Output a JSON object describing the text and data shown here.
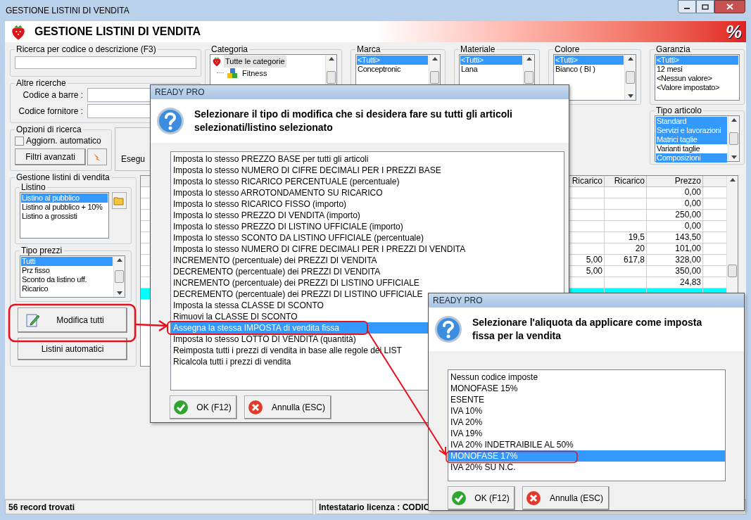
{
  "window": {
    "title": "GESTIONE LISTINI DI VENDITA"
  },
  "header": {
    "title": "GESTIONE LISTINI DI VENDITA",
    "logo": "%"
  },
  "search": {
    "title": "Ricerca per codice o descrizione (F3)"
  },
  "other_searches": {
    "title": "Altre ricerche",
    "fields": [
      {
        "label": "Codice a barre :"
      },
      {
        "label": "Codice fornitore :"
      }
    ]
  },
  "search_options": {
    "title": "Opzioni di ricerca",
    "auto_update": {
      "label": "Aggiorn. automatico",
      "checked": false
    },
    "advanced_button": "Filtri avanzati"
  },
  "execute_button": "Esegu",
  "filters": [
    {
      "title": "Categoria",
      "kind": "tree",
      "scrollable": true,
      "items": [
        {
          "label": "Tutte le categorie",
          "selected": true,
          "children": [
            {
              "label": "Fitness",
              "selected": false
            }
          ]
        }
      ]
    },
    {
      "title": "Marca",
      "kind": "list",
      "scrollable": true,
      "items": [
        {
          "label": "<Tutti>",
          "selected": true
        },
        {
          "label": "Conceptronic",
          "selected": false
        }
      ]
    },
    {
      "title": "Materiale",
      "kind": "list",
      "scrollable": true,
      "items": [
        {
          "label": "<Tutti>",
          "selected": true
        },
        {
          "label": "Lana",
          "selected": false
        }
      ]
    },
    {
      "title": "Colore",
      "kind": "list",
      "scrollable": true,
      "items": [
        {
          "label": "<Tutti>",
          "selected": true
        },
        {
          "label": "Bianco ( BI )",
          "selected": false
        }
      ]
    },
    {
      "title": "Garanzia",
      "kind": "list",
      "scrollable": false,
      "items": [
        {
          "label": "<Tutti>",
          "selected": true
        },
        {
          "label": "12 mesi",
          "selected": false
        },
        {
          "label": "<Nessun valore>",
          "selected": false
        },
        {
          "label": "<Valore impostato>",
          "selected": false
        }
      ]
    }
  ],
  "article_type": {
    "title": "Tipo articolo",
    "items": [
      {
        "label": "Standard",
        "selected": true
      },
      {
        "label": "Servizi e lavorazioni",
        "selected": true
      },
      {
        "label": "Matrici taglie",
        "selected": true
      },
      {
        "label": "Varianti taglie",
        "selected": false
      },
      {
        "label": "Composizioni",
        "selected": true
      }
    ]
  },
  "price_lists": {
    "title": "Gestione listini di vendita",
    "listino": {
      "title": "Listino",
      "items": [
        {
          "label": "Listino al pubblico",
          "selected": true
        },
        {
          "label": "Listino al pubblico + 10%",
          "selected": false
        },
        {
          "label": "Listino a grossisti",
          "selected": false
        }
      ]
    },
    "price_types": {
      "title": "Tipo prezzi",
      "items": [
        {
          "label": "Tutti",
          "selected": true
        },
        {
          "label": "Prz fisso",
          "selected": false
        },
        {
          "label": "Sconto da listino uff.",
          "selected": false
        },
        {
          "label": "Ricarico",
          "selected": false
        }
      ]
    },
    "edit_all_button": "Modifica tutti",
    "auto_lists_button": "Listini automatici"
  },
  "grid": {
    "columns": [
      "Ricarico",
      "Ricarico",
      "Prezzo"
    ],
    "rows": [
      {
        "prezzo": "0,00",
        "selected": false
      },
      {
        "prezzo": "0,00",
        "selected": false
      },
      {
        "prezzo": "250,00",
        "selected": false
      },
      {
        "prezzo": "0,00",
        "selected": false
      },
      {
        "ricarico_2": "19,5",
        "prezzo": "143,50",
        "selected": false
      },
      {
        "ricarico_2": "20",
        "prezzo": "101,00",
        "selected": false
      },
      {
        "ricarico_1": "5,00",
        "ricarico_2": "617,8",
        "prezzo": "328,00",
        "selected": false
      },
      {
        "ricarico_1": "5,00",
        "prezzo": "350,00",
        "selected": false
      },
      {
        "prezzo": "24,83",
        "selected": false
      },
      {
        "selected": true
      }
    ]
  },
  "dialog_modify": {
    "title": "READY PRO",
    "message": "Selezionare il tipo di modifica che si desidera fare su tutti gli articoli selezionati/listino selezionato",
    "options": [
      {
        "label": "Imposta lo stesso PREZZO BASE per tutti gli articoli",
        "selected": false
      },
      {
        "label": "Imposta lo stesso NUMERO DI CIFRE DECIMALI PER I PREZZI BASE",
        "selected": false
      },
      {
        "label": "Imposta lo stesso RICARICO PERCENTUALE (percentuale)",
        "selected": false
      },
      {
        "label": "Imposta lo stesso ARROTONDAMENTO SU RICARICO",
        "selected": false
      },
      {
        "label": "Imposta lo stesso RICARICO FISSO (importo)",
        "selected": false
      },
      {
        "label": "Imposta lo stesso PREZZO DI VENDITA (importo)",
        "selected": false
      },
      {
        "label": "Imposta lo stesso PREZZO DI LISTINO UFFICIALE (importo)",
        "selected": false
      },
      {
        "label": "Imposta lo stesso SCONTO DA LISTINO UFFICIALE (percentuale)",
        "selected": false
      },
      {
        "label": "Imposta lo stesso NUMERO DI CIFRE DECIMALI PER I PREZZI DI VENDITA",
        "selected": false
      },
      {
        "label": "INCREMENTO (percentuale) dei PREZZI DI VENDITA",
        "selected": false
      },
      {
        "label": "DECREMENTO (percentuale) dei PREZZI DI VENDITA",
        "selected": false
      },
      {
        "label": "INCREMENTO (percentuale) dei PREZZI DI LISTINO UFFICIALE",
        "selected": false
      },
      {
        "label": "DECREMENTO (percentuale) dei PREZZI DI LISTINO UFFICIALE",
        "selected": false
      },
      {
        "label": "Imposta la stessa CLASSE DI SCONTO",
        "selected": false
      },
      {
        "label": "Rimuovi la CLASSE DI SCONTO",
        "selected": false
      },
      {
        "label": "Assegna la stessa IMPOSTA di vendita fissa",
        "selected": true
      },
      {
        "label": "Imposta lo stesso LOTTO DI VENDITA (quantità)",
        "selected": false
      },
      {
        "label": "Reimposta tutti i prezzi di vendita in base alle regole dei LIST",
        "selected": false
      },
      {
        "label": "Ricalcola tutti i prezzi di vendita",
        "selected": false
      }
    ],
    "buttons": [
      {
        "kind": "ok",
        "label": "OK (F12)"
      },
      {
        "kind": "cancel",
        "label": "Annulla (ESC)"
      }
    ]
  },
  "dialog_tax": {
    "title": "READY PRO",
    "message": "Selezionare l'aliquota da applicare come imposta fissa per la vendita",
    "options": [
      {
        "label": "Nessun codice imposte",
        "selected": false
      },
      {
        "label": "MONOFASE 15%",
        "selected": false
      },
      {
        "label": "ESENTE",
        "selected": false
      },
      {
        "label": "IVA 10%",
        "selected": false
      },
      {
        "label": "IVA 20%",
        "selected": false
      },
      {
        "label": "IVA 19%",
        "selected": false
      },
      {
        "label": "IVA 20% INDETRAIBILE AL 50%",
        "selected": false
      },
      {
        "label": "MONOFASE 17%",
        "selected": true
      },
      {
        "label": "IVA 20% SU N.C.",
        "selected": false
      }
    ],
    "buttons": [
      {
        "kind": "ok",
        "label": "OK (F12)"
      },
      {
        "kind": "cancel",
        "label": "Annulla (ESC)"
      }
    ]
  },
  "status_bar": [
    "56 record trovati",
    "Intestatario licenza : CODIC"
  ]
}
